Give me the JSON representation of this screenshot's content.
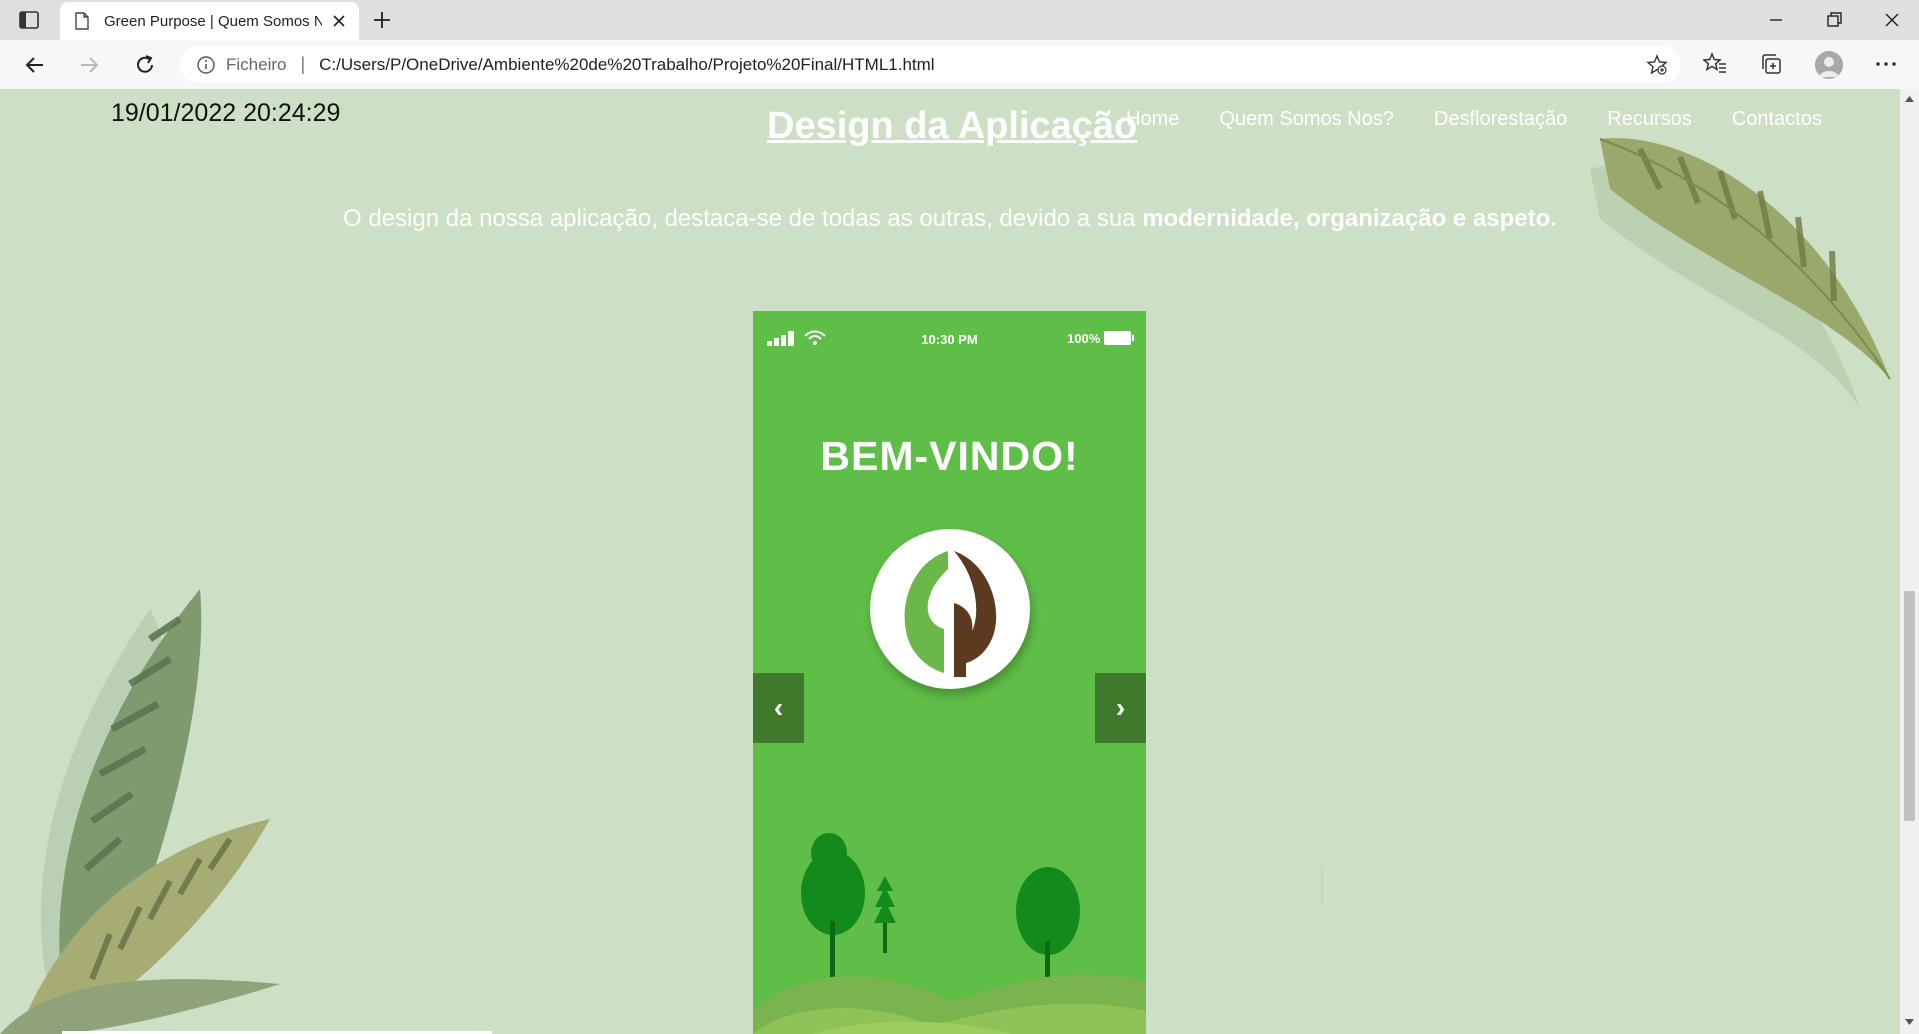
{
  "browser": {
    "tab_title": "Green Purpose | Quem Somos N",
    "scheme_label": "Ficheiro",
    "separator": "|",
    "url": "C:/Users/P/OneDrive/Ambiente%20de%20Trabalho/Projeto%20Final/HTML1.html"
  },
  "page": {
    "datetime": "19/01/2022 20:24:29",
    "heading": "Design da Aplicação",
    "nav": [
      "Home",
      "Quem Somos Nos?",
      "Desflorestação",
      "Recursos",
      "Contactos"
    ],
    "intro_plain": "O design da nossa aplicação, destaca-se de todas as outras, devido a sua ",
    "intro_bold": "modernidade, organização e aspeto."
  },
  "phone": {
    "time": "10:30 PM",
    "battery": "100%",
    "welcome": "BEM-VINDO!",
    "prev_label": "‹",
    "next_label": "›"
  },
  "colors": {
    "page_bg": "#cddfc4",
    "phone_green": "#5fbe47",
    "arrow_bg": "#3f7a2c",
    "logo_green": "#6cb74a",
    "logo_brown": "#5b3a1f"
  },
  "icons": [
    "sidebar-icon",
    "page-icon",
    "close-icon",
    "plus-icon",
    "minimize-icon",
    "restore-icon",
    "back-icon",
    "forward-icon",
    "refresh-icon",
    "info-icon",
    "add-favorite-icon",
    "favorites-icon",
    "collections-icon",
    "profile-icon",
    "more-icon",
    "signal-icon",
    "wifi-icon",
    "battery-icon"
  ]
}
